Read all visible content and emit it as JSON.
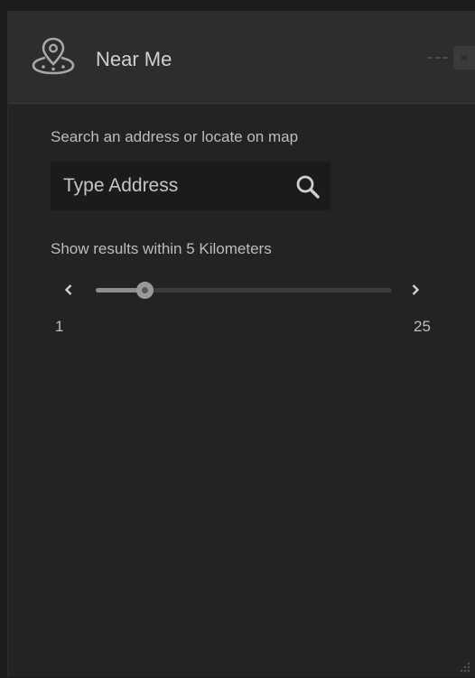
{
  "header": {
    "title": "Near Me",
    "app_icon": "location-pin-icon",
    "minimize_icon": "minimize-icon",
    "close_icon": "close-icon"
  },
  "search": {
    "instruction": "Search an address or locate on map",
    "placeholder": "Type Address",
    "value": "",
    "button_icon": "search-icon"
  },
  "radius": {
    "label": "Show results within 5 Kilometers",
    "min": "1",
    "max": "25",
    "value": 5,
    "prev_icon": "chevron-left-icon",
    "next_icon": "chevron-right-icon"
  },
  "colors": {
    "panel_bg": "#232323",
    "header_bg": "#2d2d2d",
    "text": "#bdbdbd",
    "input_bg": "#1b1b1b"
  }
}
